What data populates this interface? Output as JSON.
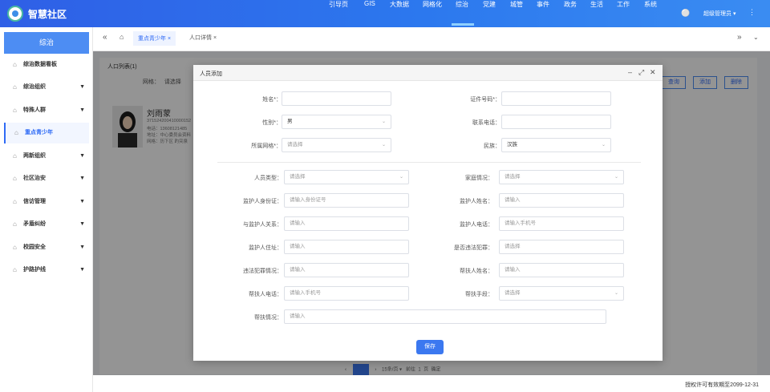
{
  "app": {
    "title": "智慧社区"
  },
  "nav": {
    "items": [
      "引导页",
      "GIS",
      "大数据",
      "网格化",
      "综治",
      "党建",
      "城管",
      "事件",
      "政务",
      "生活",
      "工作",
      "系统"
    ],
    "active": "综治"
  },
  "user": {
    "name": "超级管理员"
  },
  "sidebar": {
    "header": "综治",
    "items": [
      {
        "label": "综治数据看板"
      },
      {
        "label": "综治组织"
      },
      {
        "label": "特殊人群"
      },
      {
        "label": "重点青少年"
      },
      {
        "label": "两新组织"
      },
      {
        "label": "社区治安"
      },
      {
        "label": "信访管理"
      },
      {
        "label": "矛盾纠纷"
      },
      {
        "label": "校园安全"
      },
      {
        "label": "护路护线"
      }
    ]
  },
  "tabs": {
    "items": [
      "重点青少年",
      "人口详情"
    ]
  },
  "background": {
    "list_title": "人口列表(1)",
    "filter_label": "网格：",
    "filter_value": "请选择",
    "buttons": [
      "查询",
      "添加",
      "删除"
    ],
    "card": {
      "name": "刘雨蒙",
      "lines": [
        "371524200410000152",
        "电话：13608121485",
        "地址：中心委员会资料",
        "网格：历下区 趵突泉"
      ]
    },
    "pager": {
      "size": "15条/页",
      "goto_label": "前往",
      "page": "1",
      "page_unit": "页",
      "confirm": "确定"
    }
  },
  "footer": {
    "license": "授权许可有效期至2099-12-31"
  },
  "modal": {
    "title": "人员添加",
    "fields_top": [
      {
        "label": "姓名*：",
        "value": "",
        "placeholder": "",
        "type": "text"
      },
      {
        "label": "证件号码*：",
        "value": "",
        "placeholder": "",
        "type": "text"
      },
      {
        "label": "性别*：",
        "value": "男",
        "placeholder": "",
        "type": "select"
      },
      {
        "label": "联系电话：",
        "value": "",
        "placeholder": "",
        "type": "text"
      },
      {
        "label": "所属网格*：",
        "value": "",
        "placeholder": "请选择",
        "type": "select"
      },
      {
        "label": "民族：",
        "value": "汉族",
        "placeholder": "",
        "type": "select"
      }
    ],
    "fields_bottom": [
      {
        "label": "人员类型：",
        "placeholder": "请选择",
        "type": "select"
      },
      {
        "label": "家庭情况：",
        "placeholder": "请选择",
        "type": "select"
      },
      {
        "label": "监护人身份证：",
        "placeholder": "请输入身份证号",
        "type": "text"
      },
      {
        "label": "监护人姓名：",
        "placeholder": "请输入",
        "type": "text"
      },
      {
        "label": "与监护人关系：",
        "placeholder": "请输入",
        "type": "text"
      },
      {
        "label": "监护人电话：",
        "placeholder": "请输入手机号",
        "type": "text"
      },
      {
        "label": "监护人住址：",
        "placeholder": "请输入",
        "type": "text"
      },
      {
        "label": "是否违法犯罪：",
        "placeholder": "请选择",
        "type": "text"
      },
      {
        "label": "违法犯罪情况：",
        "placeholder": "请输入",
        "type": "text"
      },
      {
        "label": "帮扶人姓名：",
        "placeholder": "请输入",
        "type": "text"
      },
      {
        "label": "帮扶人电话：",
        "placeholder": "请输入手机号",
        "type": "text"
      },
      {
        "label": "帮扶手段：",
        "placeholder": "请选择",
        "type": "select"
      }
    ],
    "help_field": {
      "label": "帮扶情况：",
      "placeholder": "请输入"
    },
    "save_label": "保存"
  },
  "colors": {
    "topbar": "#2f6fea",
    "accent": "#3b78f0"
  }
}
